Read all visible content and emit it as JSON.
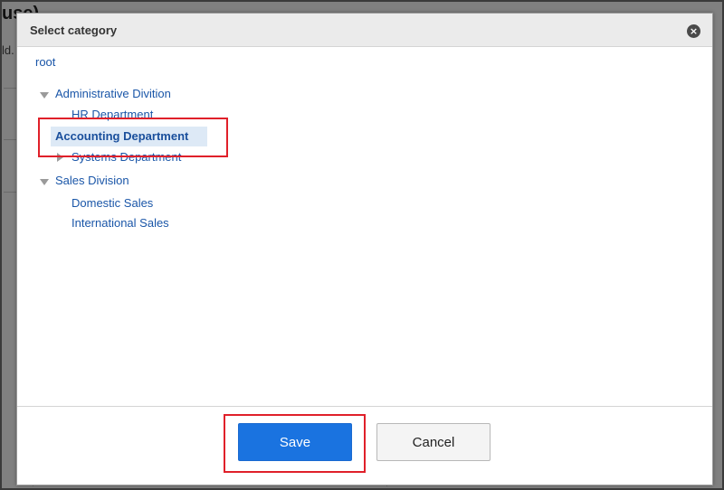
{
  "background": {
    "heading_fragment": "use)",
    "text_fragment": "ld."
  },
  "dialog": {
    "title": "Select category",
    "close_glyph": "×",
    "tree": {
      "root": "root",
      "groups": [
        {
          "label": "Administrative Divition",
          "expanded": true,
          "children": [
            {
              "label": "HR Department",
              "selected": false,
              "has_children": false
            },
            {
              "label": "Accounting Department",
              "selected": true,
              "has_children": false
            },
            {
              "label": "Systems Department",
              "selected": false,
              "has_children": true,
              "expanded": false
            }
          ]
        },
        {
          "label": "Sales Division",
          "expanded": true,
          "children": [
            {
              "label": "Domestic Sales",
              "selected": false,
              "has_children": false
            },
            {
              "label": "International Sales",
              "selected": false,
              "has_children": false
            }
          ]
        }
      ]
    },
    "buttons": {
      "save": "Save",
      "cancel": "Cancel"
    }
  },
  "colors": {
    "link": "#1a56a8",
    "selected_bg": "#dde9f6",
    "primary_button": "#1a73e0",
    "highlight_border": "#e0202a"
  }
}
